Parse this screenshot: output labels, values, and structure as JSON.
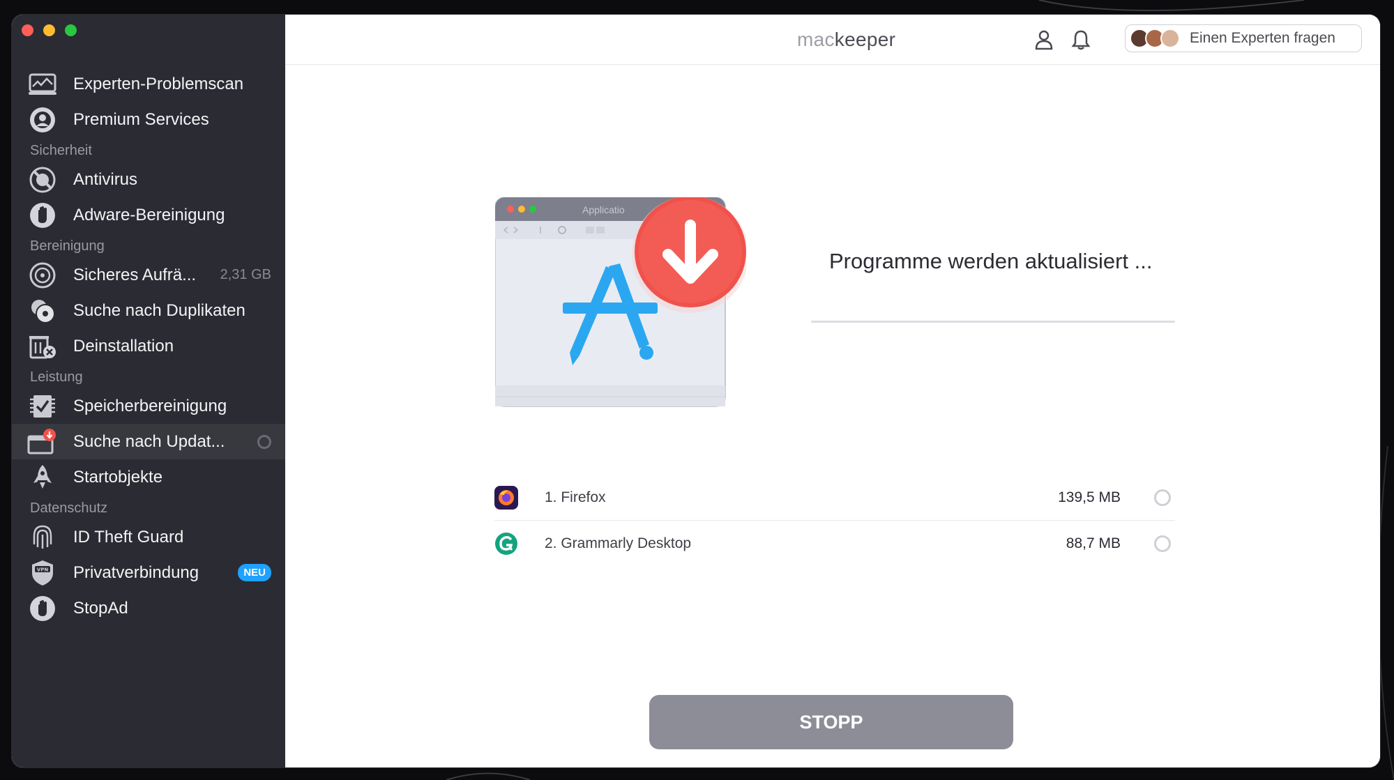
{
  "app": {
    "logo_part1": "mac",
    "logo_part2": "keeper"
  },
  "header": {
    "expert_button_label": "Einen Experten fragen"
  },
  "sidebar": {
    "top_items": [
      {
        "label": "Experten-Problemscan",
        "icon": "monitor-scan-icon"
      },
      {
        "label": "Premium Services",
        "icon": "headset-icon"
      }
    ],
    "sections": [
      {
        "title": "Sicherheit",
        "items": [
          {
            "label": "Antivirus",
            "icon": "antivirus-icon"
          },
          {
            "label": "Adware-Bereinigung",
            "icon": "hand-stop-icon"
          }
        ]
      },
      {
        "title": "Bereinigung",
        "items": [
          {
            "label": "Sicheres Aufrä...",
            "icon": "disk-clean-icon",
            "meta": "2,31 GB"
          },
          {
            "label": "Suche nach Duplikaten",
            "icon": "duplicates-icon"
          },
          {
            "label": "Deinstallation",
            "icon": "uninstall-icon"
          }
        ]
      },
      {
        "title": "Leistung",
        "items": [
          {
            "label": "Speicherbereinigung",
            "icon": "memory-check-icon"
          },
          {
            "label": "Suche nach Updat...",
            "icon": "update-icon",
            "active": true
          },
          {
            "label": "Startobjekte",
            "icon": "rocket-icon"
          }
        ]
      },
      {
        "title": "Datenschutz",
        "items": [
          {
            "label": "ID Theft Guard",
            "icon": "fingerprint-icon"
          },
          {
            "label": "Privatverbindung",
            "icon": "vpn-shield-icon",
            "badge": "NEU"
          },
          {
            "label": "StopAd",
            "icon": "stopad-hand-icon"
          }
        ]
      }
    ]
  },
  "main": {
    "illustration": {
      "window_title": "Applicatio"
    },
    "status_text": "Programme werden aktualisiert ...",
    "progress": 0,
    "apps": [
      {
        "name": "1. Firefox",
        "size": "139,5 MB",
        "icon": "firefox-icon"
      },
      {
        "name": "2. Grammarly Desktop",
        "size": "88,7 MB",
        "icon": "grammarly-icon"
      }
    ],
    "stop_button": "STOPP"
  },
  "colors": {
    "sidebar_bg": "#2b2b33",
    "accent_blue": "#1fa1ff",
    "download_red": "#f0524b",
    "stop_button": "#8d8d98"
  }
}
